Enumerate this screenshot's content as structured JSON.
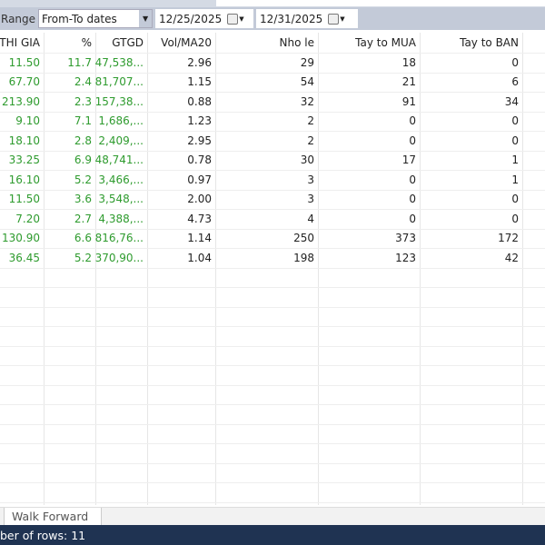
{
  "toolbar": {
    "range_label": "Range",
    "range_value": "From-To dates",
    "from_date": "12/25/2025",
    "to_date": "12/31/2025"
  },
  "columns": [
    "THI GIA",
    "%",
    "GTGD",
    "Vol/MA20",
    "Nho le",
    "Tay to MUA",
    "Tay to BAN"
  ],
  "rows": [
    [
      "11.50",
      "11.7",
      "47,538...",
      "2.96",
      "29",
      "18",
      "0"
    ],
    [
      "67.70",
      "2.4",
      "81,707...",
      "1.15",
      "54",
      "21",
      "6"
    ],
    [
      "213.90",
      "2.3",
      "157,38...",
      "0.88",
      "32",
      "91",
      "34"
    ],
    [
      "9.10",
      "7.1",
      "1,686,...",
      "1.23",
      "2",
      "0",
      "0"
    ],
    [
      "18.10",
      "2.8",
      "2,409,...",
      "2.95",
      "2",
      "0",
      "0"
    ],
    [
      "33.25",
      "6.9",
      "48,741...",
      "0.78",
      "30",
      "17",
      "1"
    ],
    [
      "16.10",
      "5.2",
      "3,466,...",
      "0.97",
      "3",
      "0",
      "1"
    ],
    [
      "11.50",
      "3.6",
      "3,548,...",
      "2.00",
      "3",
      "0",
      "0"
    ],
    [
      "7.20",
      "2.7",
      "4,388,...",
      "4.73",
      "4",
      "0",
      "0"
    ],
    [
      "130.90",
      "6.6",
      "816,76...",
      "1.14",
      "250",
      "373",
      "172"
    ],
    [
      "36.45",
      "5.2",
      "370,90...",
      "1.04",
      "198",
      "123",
      "42"
    ]
  ],
  "sheet_tab": "Walk Forward",
  "status": "ber of rows: 11",
  "colors": {
    "positive": "#2e9b2e",
    "status_bar": "#1f3352"
  }
}
